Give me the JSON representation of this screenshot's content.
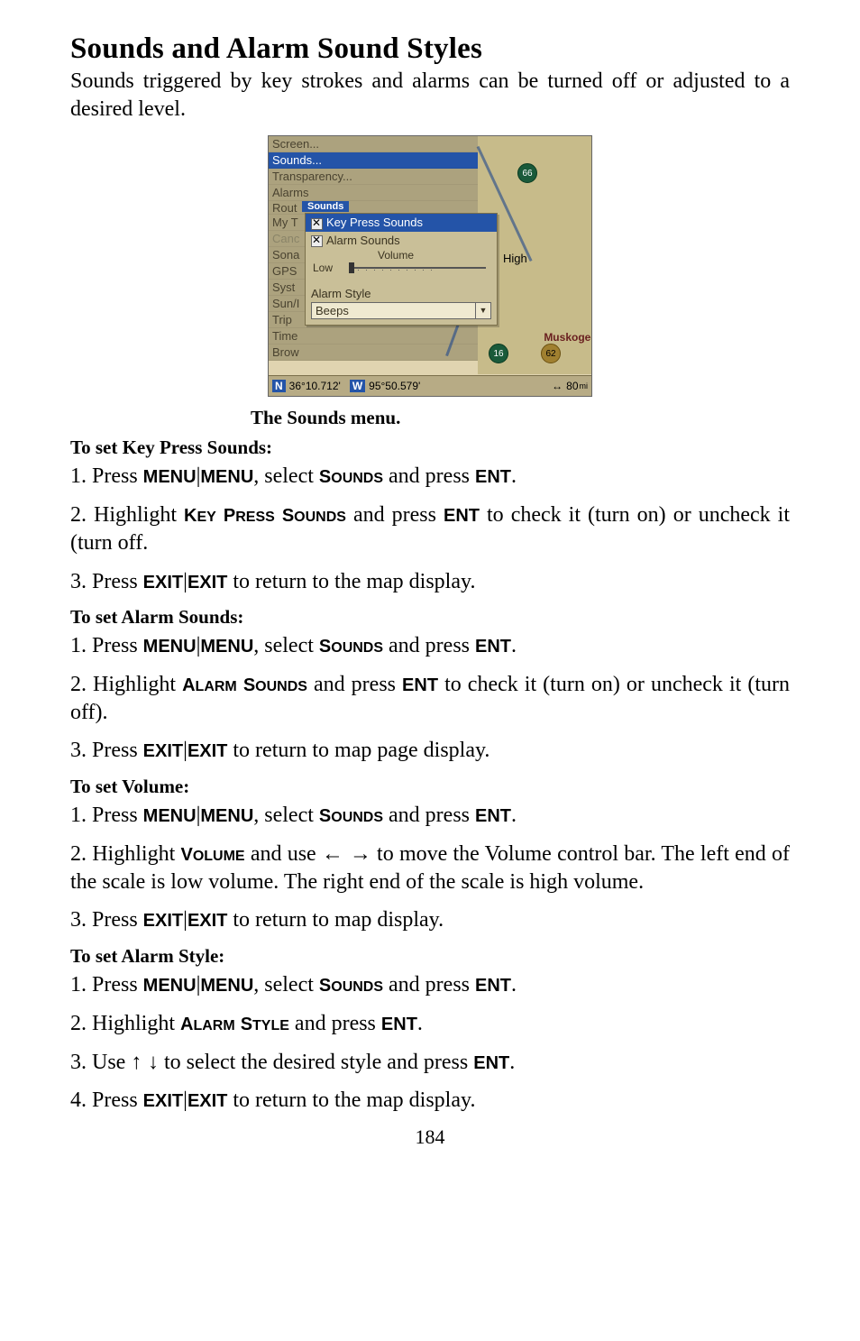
{
  "title": "Sounds and Alarm Sound Styles",
  "intro": "Sounds triggered by key strokes and alarms can be turned off or adjusted to a desired level.",
  "caption": "The Sounds menu.",
  "screenshot": {
    "menu_items": {
      "screen": "Screen...",
      "sounds": "Sounds...",
      "transparency": "Transparency...",
      "alarms": "Alarms",
      "route": "Rout",
      "mytrails": "My T",
      "cancel": "Canc",
      "sonar": "Sona",
      "gps": "GPS",
      "system": "Syst",
      "sunmoon": "Sun/I",
      "trip": "Trip",
      "timers": "Time",
      "browse": "Brow"
    },
    "popup": {
      "title": "Sounds",
      "key_press": "Key Press Sounds",
      "alarm_sounds": "Alarm Sounds",
      "volume_label": "Volume",
      "low": "Low",
      "high": "High",
      "alarm_style_label": "Alarm Style",
      "alarm_style_value": "Beeps"
    },
    "map": {
      "hwy1": "66",
      "hwy2": "16",
      "hwy3": "62",
      "city": "Muskogee"
    },
    "status": {
      "ns": "N",
      "lat": "36°10.712'",
      "ew": "W",
      "lon": "95°50.579'",
      "range": "80",
      "unit": "mi"
    }
  },
  "sections": [
    {
      "heading": "To set Key Press Sounds:",
      "steps": [
        {
          "parts": [
            {
              "t": "1. Press "
            },
            {
              "cmd": "MENU"
            },
            {
              "t": "|"
            },
            {
              "cmd": "MENU"
            },
            {
              "t": ", select "
            },
            {
              "sc": [
                "S",
                "OUNDS"
              ]
            },
            {
              "t": " and press "
            },
            {
              "cmd": "ENT"
            },
            {
              "t": "."
            }
          ]
        },
        {
          "parts": [
            {
              "t": "2. Highlight "
            },
            {
              "sc": [
                "K",
                "EY"
              ]
            },
            {
              "t": " "
            },
            {
              "sc": [
                "P",
                "RESS"
              ]
            },
            {
              "t": " "
            },
            {
              "sc": [
                "S",
                "OUNDS"
              ]
            },
            {
              "t": " and press "
            },
            {
              "cmd": "ENT"
            },
            {
              "t": " to check it (turn on) or uncheck it (turn off."
            }
          ]
        },
        {
          "parts": [
            {
              "t": "3. Press "
            },
            {
              "cmd": "EXIT"
            },
            {
              "t": "|"
            },
            {
              "cmd": "EXIT"
            },
            {
              "t": " to return to the map display."
            }
          ]
        }
      ]
    },
    {
      "heading": "To set Alarm Sounds:",
      "steps": [
        {
          "parts": [
            {
              "t": "1. Press "
            },
            {
              "cmd": "MENU"
            },
            {
              "t": "|"
            },
            {
              "cmd": "MENU"
            },
            {
              "t": ", select "
            },
            {
              "sc": [
                "S",
                "OUNDS"
              ]
            },
            {
              "t": " and press "
            },
            {
              "cmd": "ENT"
            },
            {
              "t": "."
            }
          ]
        },
        {
          "parts": [
            {
              "t": "2. Highlight "
            },
            {
              "sc": [
                "A",
                "LARM"
              ]
            },
            {
              "t": " "
            },
            {
              "sc": [
                "S",
                "OUNDS"
              ]
            },
            {
              "t": " and press "
            },
            {
              "cmd": "ENT"
            },
            {
              "t": " to check it (turn on) or uncheck it (turn off)."
            }
          ]
        },
        {
          "parts": [
            {
              "t": "3. Press "
            },
            {
              "cmd": "EXIT"
            },
            {
              "t": "|"
            },
            {
              "cmd": "EXIT"
            },
            {
              "t": " to return to map page display."
            }
          ]
        }
      ]
    },
    {
      "heading": "To set Volume:",
      "steps": [
        {
          "parts": [
            {
              "t": "1. Press "
            },
            {
              "cmd": "MENU"
            },
            {
              "t": "|"
            },
            {
              "cmd": "MENU"
            },
            {
              "t": ", select "
            },
            {
              "sc": [
                "S",
                "OUNDS"
              ]
            },
            {
              "t": " and press "
            },
            {
              "cmd": "ENT"
            },
            {
              "t": "."
            }
          ]
        },
        {
          "parts": [
            {
              "t": "2. Highlight "
            },
            {
              "sc": [
                "V",
                "OLUME"
              ]
            },
            {
              "t": " and use "
            },
            {
              "ar": "← →"
            },
            {
              "t": " to move the Volume control bar. The left end of the scale is low volume. The right end of the scale is high volume."
            }
          ]
        },
        {
          "parts": [
            {
              "t": "3. Press "
            },
            {
              "cmd": "EXIT"
            },
            {
              "t": "|"
            },
            {
              "cmd": "EXIT"
            },
            {
              "t": " to return to map display."
            }
          ]
        }
      ]
    },
    {
      "heading": "To set Alarm Style:",
      "steps": [
        {
          "parts": [
            {
              "t": "1. Press "
            },
            {
              "cmd": "MENU"
            },
            {
              "t": "|"
            },
            {
              "cmd": "MENU"
            },
            {
              "t": ", select "
            },
            {
              "sc": [
                "S",
                "OUNDS"
              ]
            },
            {
              "t": " and press "
            },
            {
              "cmd": "ENT"
            },
            {
              "t": "."
            }
          ]
        },
        {
          "parts": [
            {
              "t": "2. Highlight "
            },
            {
              "sc": [
                "A",
                "LARM"
              ]
            },
            {
              "t": " "
            },
            {
              "sc": [
                "S",
                "TYLE"
              ]
            },
            {
              "t": " and press "
            },
            {
              "cmd": "ENT"
            },
            {
              "t": "."
            }
          ]
        },
        {
          "parts": [
            {
              "t": "3. Use "
            },
            {
              "ar": "↑ ↓"
            },
            {
              "t": " to select the desired style and press "
            },
            {
              "cmd": "ENT"
            },
            {
              "t": "."
            }
          ]
        },
        {
          "parts": [
            {
              "t": "4. Press "
            },
            {
              "cmd": "EXIT"
            },
            {
              "t": "|"
            },
            {
              "cmd": "EXIT"
            },
            {
              "t": " to return to the map display."
            }
          ]
        }
      ]
    }
  ],
  "page_number": "184"
}
